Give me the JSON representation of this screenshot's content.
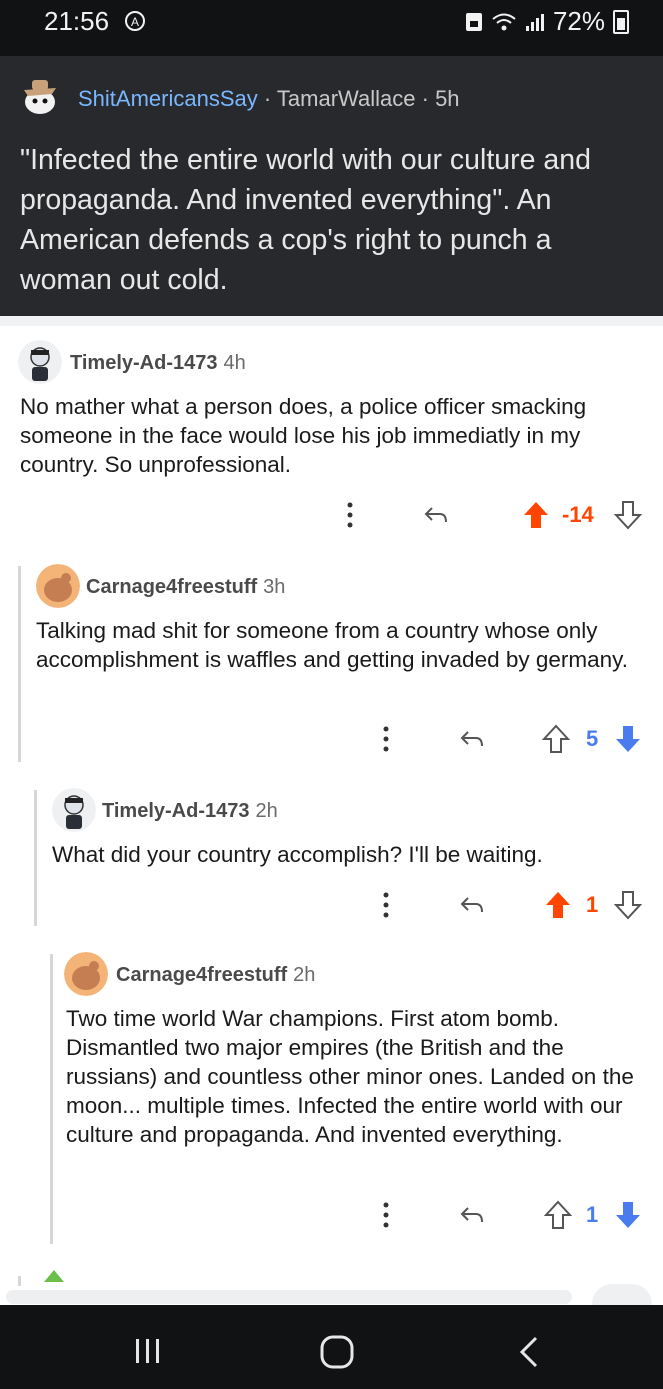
{
  "status_bar": {
    "time": "21:56",
    "battery": "72%",
    "icons": [
      "cast-icon",
      "save-icon",
      "wifi-icon",
      "signal-icon",
      "battery-icon"
    ]
  },
  "post": {
    "subreddit": "ShitAmericansSay",
    "separator": "·",
    "author": "TamarWallace",
    "age": "5h",
    "title": "\"Infected the entire world with our culture and propaganda. And invented everything\". An American defends a cop's right to punch a woman out cold."
  },
  "comments": [
    {
      "username": "Timely-Ad-1473",
      "age": "4h",
      "body": "No mather what a person does, a police officer smacking someone in the face would lose his job immediatly in my country. So unprofessional.",
      "score": "-14",
      "vote": "up"
    },
    {
      "username": "Carnage4freestuff",
      "age": "3h",
      "body": "Talking mad shit for someone from a country whose only accomplishment is waffles and getting invaded by germany.",
      "score": "5",
      "vote": "down"
    },
    {
      "username": "Timely-Ad-1473",
      "age": "2h",
      "body": "What did your country accomplish? I'll be waiting.",
      "score": "1",
      "vote": "up"
    },
    {
      "username": "Carnage4freestuff",
      "age": "2h",
      "body": "Two time world War champions. First atom bomb. Dismantled two major empires (the British and the russians) and countless other minor ones. Landed on the moon... multiple times. Infected the entire world with our culture and propaganda. And invented everything.",
      "score": "1",
      "vote": "down"
    }
  ],
  "colors": {
    "upvote": "#ff4500",
    "downvote": "#4a7cf0",
    "link": "#79b7ff",
    "post_bg": "#28292c"
  },
  "navigation": [
    "recent-apps-icon",
    "home-icon",
    "back-icon"
  ]
}
